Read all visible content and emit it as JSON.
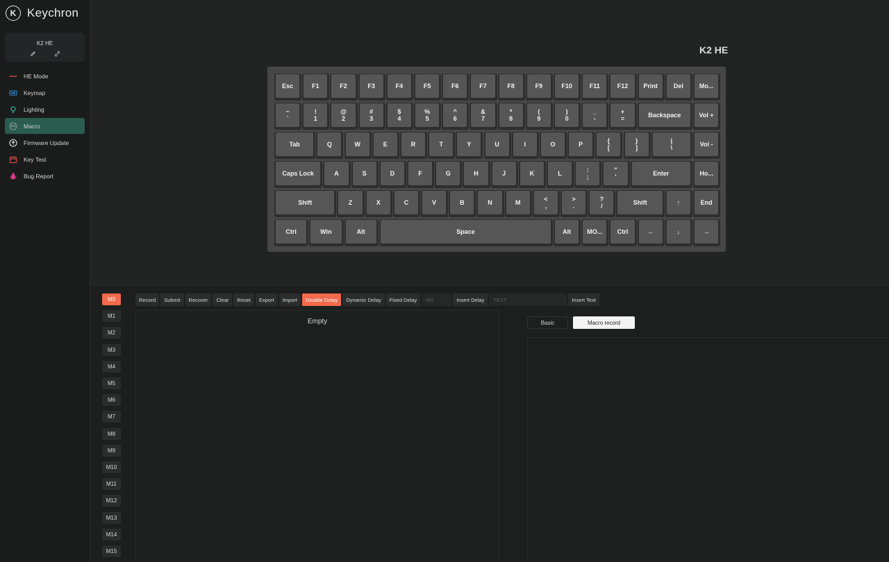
{
  "brand": {
    "logo": "K",
    "name": "Keychron"
  },
  "device": {
    "name": "K2 HE",
    "icons": [
      "pencil-icon",
      "link-icon"
    ]
  },
  "nav": [
    {
      "label": "HE Mode",
      "icon": "he-mode-icon",
      "color": "#e05a4a",
      "active": false
    },
    {
      "label": "Keymap",
      "icon": "keymap-icon",
      "color": "#2b7fc4",
      "active": false
    },
    {
      "label": "Lighting",
      "icon": "lighting-icon",
      "color": "#2fb89a",
      "active": false
    },
    {
      "label": "Macro",
      "icon": "macro-icon",
      "color": "#8a9a96",
      "active": true
    },
    {
      "label": "Firmware Update",
      "icon": "firmware-icon",
      "color": "#e8e8e8",
      "active": false
    },
    {
      "label": "Key Test",
      "icon": "key-test-icon",
      "color": "#e0564a",
      "active": false
    },
    {
      "label": "Bug Report",
      "icon": "bug-icon",
      "color": "#e03c8c",
      "active": false
    }
  ],
  "keyboard": {
    "title": "K2 HE",
    "rows": [
      [
        {
          "t": "Esc",
          "u": 1
        },
        {
          "t": "F1",
          "u": 1
        },
        {
          "t": "F2",
          "u": 1
        },
        {
          "t": "F3",
          "u": 1
        },
        {
          "t": "F4",
          "u": 1
        },
        {
          "t": "F5",
          "u": 1
        },
        {
          "t": "F6",
          "u": 1
        },
        {
          "t": "F7",
          "u": 1
        },
        {
          "t": "F8",
          "u": 1
        },
        {
          "t": "F9",
          "u": 1
        },
        {
          "t": "F10",
          "u": 1
        },
        {
          "t": "F11",
          "u": 1
        },
        {
          "t": "F12",
          "u": 1
        },
        {
          "t": "Print",
          "u": 1
        },
        {
          "t": "Del",
          "u": 1
        },
        {
          "t": "Mo...",
          "u": 1
        }
      ],
      [
        {
          "t": "~",
          "b": "`",
          "u": 1
        },
        {
          "t": "!",
          "b": "1",
          "u": 1
        },
        {
          "t": "@",
          "b": "2",
          "u": 1
        },
        {
          "t": "#",
          "b": "3",
          "u": 1
        },
        {
          "t": "$",
          "b": "4",
          "u": 1
        },
        {
          "t": "%",
          "b": "5",
          "u": 1
        },
        {
          "t": "^",
          "b": "6",
          "u": 1
        },
        {
          "t": "&",
          "b": "7",
          "u": 1
        },
        {
          "t": "*",
          "b": "8",
          "u": 1
        },
        {
          "t": "(",
          "b": "9",
          "u": 1
        },
        {
          "t": ")",
          "b": "0",
          "u": 1
        },
        {
          "t": "_",
          "b": "-",
          "u": 1
        },
        {
          "t": "+",
          "b": "=",
          "u": 1
        },
        {
          "t": "Backspace",
          "u": 2
        },
        {
          "t": "Vol +",
          "u": 1
        }
      ],
      [
        {
          "t": "Tab",
          "u": 1.5
        },
        {
          "t": "Q",
          "u": 1
        },
        {
          "t": "W",
          "u": 1
        },
        {
          "t": "E",
          "u": 1
        },
        {
          "t": "R",
          "u": 1
        },
        {
          "t": "T",
          "u": 1
        },
        {
          "t": "Y",
          "u": 1
        },
        {
          "t": "U",
          "u": 1
        },
        {
          "t": "I",
          "u": 1
        },
        {
          "t": "O",
          "u": 1
        },
        {
          "t": "P",
          "u": 1
        },
        {
          "t": "{",
          "b": "[",
          "u": 1
        },
        {
          "t": "}",
          "b": "]",
          "u": 1
        },
        {
          "t": "|",
          "b": "\\",
          "u": 1.5
        },
        {
          "t": "Vol -",
          "u": 1
        }
      ],
      [
        {
          "t": "Caps Lock",
          "u": 1.75
        },
        {
          "t": "A",
          "u": 1
        },
        {
          "t": "S",
          "u": 1
        },
        {
          "t": "D",
          "u": 1
        },
        {
          "t": "F",
          "u": 1
        },
        {
          "t": "G",
          "u": 1
        },
        {
          "t": "H",
          "u": 1
        },
        {
          "t": "J",
          "u": 1
        },
        {
          "t": "K",
          "u": 1
        },
        {
          "t": "L",
          "u": 1
        },
        {
          "t": ":",
          "b": ";",
          "u": 1
        },
        {
          "t": "\"",
          "b": "'",
          "u": 1
        },
        {
          "t": "Enter",
          "u": 2.25
        },
        {
          "t": "Ho...",
          "u": 1
        }
      ],
      [
        {
          "t": "Shift",
          "u": 2.25
        },
        {
          "t": "Z",
          "u": 1
        },
        {
          "t": "X",
          "u": 1
        },
        {
          "t": "C",
          "u": 1
        },
        {
          "t": "V",
          "u": 1
        },
        {
          "t": "B",
          "u": 1
        },
        {
          "t": "N",
          "u": 1
        },
        {
          "t": "M",
          "u": 1
        },
        {
          "t": "<",
          "b": ",",
          "u": 1
        },
        {
          "t": ">",
          "b": ".",
          "u": 1
        },
        {
          "t": "?",
          "b": "/",
          "u": 1
        },
        {
          "t": "Shift",
          "u": 1.75
        },
        {
          "t": "↑",
          "u": 1
        },
        {
          "t": "End",
          "u": 1
        }
      ],
      [
        {
          "t": "Ctrl",
          "u": 1.25
        },
        {
          "t": "Win",
          "u": 1.25
        },
        {
          "t": "Alt",
          "u": 1.25
        },
        {
          "t": "Space",
          "u": 6.25
        },
        {
          "t": "Alt",
          "u": 1
        },
        {
          "t": "MO...",
          "u": 1
        },
        {
          "t": "Ctrl",
          "u": 1
        },
        {
          "t": "←",
          "u": 1
        },
        {
          "t": "↓",
          "u": 1
        },
        {
          "t": "→",
          "u": 1
        }
      ]
    ]
  },
  "macros": [
    "M0",
    "M1",
    "M2",
    "M3",
    "M4",
    "M5",
    "M6",
    "M7",
    "M8",
    "M9",
    "M10",
    "M11",
    "M12",
    "M13",
    "M14",
    "M15"
  ],
  "macro_selected": "M0",
  "toolbar": {
    "record": "Record",
    "submit": "Submit",
    "recover": "Recover",
    "clear": "Clear",
    "reset": "Reset",
    "export": "Export",
    "import": "Import",
    "disable_delay": "Disable Delay",
    "dynamic_delay": "Dynamic Delay",
    "fixed_delay": "Fixed Delay",
    "ms_placeholder": "MS",
    "insert_delay": "Insert Delay",
    "text_placeholder": "TEXT",
    "insert_text": "Insert Text"
  },
  "editor": {
    "empty_text": "Empty"
  },
  "tabs": {
    "basic": "Basic",
    "macro_record": "Macro record"
  },
  "colors": {
    "accent": "#f26a4b",
    "active_nav": "#2a5c50"
  }
}
